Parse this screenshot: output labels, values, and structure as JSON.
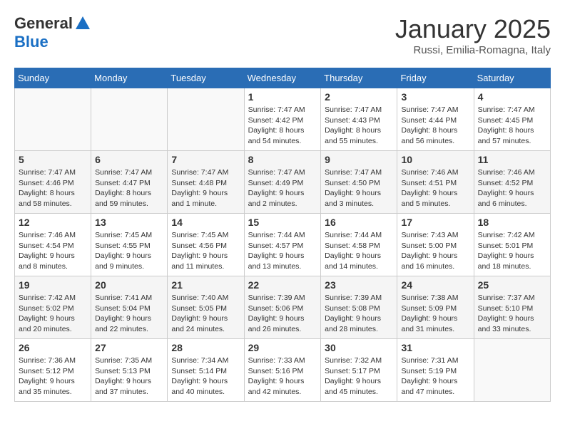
{
  "logo": {
    "general": "General",
    "blue": "Blue"
  },
  "title": "January 2025",
  "location": "Russi, Emilia-Romagna, Italy",
  "days_of_week": [
    "Sunday",
    "Monday",
    "Tuesday",
    "Wednesday",
    "Thursday",
    "Friday",
    "Saturday"
  ],
  "weeks": [
    [
      {
        "day": "",
        "info": ""
      },
      {
        "day": "",
        "info": ""
      },
      {
        "day": "",
        "info": ""
      },
      {
        "day": "1",
        "info": "Sunrise: 7:47 AM\nSunset: 4:42 PM\nDaylight: 8 hours\nand 54 minutes."
      },
      {
        "day": "2",
        "info": "Sunrise: 7:47 AM\nSunset: 4:43 PM\nDaylight: 8 hours\nand 55 minutes."
      },
      {
        "day": "3",
        "info": "Sunrise: 7:47 AM\nSunset: 4:44 PM\nDaylight: 8 hours\nand 56 minutes."
      },
      {
        "day": "4",
        "info": "Sunrise: 7:47 AM\nSunset: 4:45 PM\nDaylight: 8 hours\nand 57 minutes."
      }
    ],
    [
      {
        "day": "5",
        "info": "Sunrise: 7:47 AM\nSunset: 4:46 PM\nDaylight: 8 hours\nand 58 minutes."
      },
      {
        "day": "6",
        "info": "Sunrise: 7:47 AM\nSunset: 4:47 PM\nDaylight: 8 hours\nand 59 minutes."
      },
      {
        "day": "7",
        "info": "Sunrise: 7:47 AM\nSunset: 4:48 PM\nDaylight: 9 hours\nand 1 minute."
      },
      {
        "day": "8",
        "info": "Sunrise: 7:47 AM\nSunset: 4:49 PM\nDaylight: 9 hours\nand 2 minutes."
      },
      {
        "day": "9",
        "info": "Sunrise: 7:47 AM\nSunset: 4:50 PM\nDaylight: 9 hours\nand 3 minutes."
      },
      {
        "day": "10",
        "info": "Sunrise: 7:46 AM\nSunset: 4:51 PM\nDaylight: 9 hours\nand 5 minutes."
      },
      {
        "day": "11",
        "info": "Sunrise: 7:46 AM\nSunset: 4:52 PM\nDaylight: 9 hours\nand 6 minutes."
      }
    ],
    [
      {
        "day": "12",
        "info": "Sunrise: 7:46 AM\nSunset: 4:54 PM\nDaylight: 9 hours\nand 8 minutes."
      },
      {
        "day": "13",
        "info": "Sunrise: 7:45 AM\nSunset: 4:55 PM\nDaylight: 9 hours\nand 9 minutes."
      },
      {
        "day": "14",
        "info": "Sunrise: 7:45 AM\nSunset: 4:56 PM\nDaylight: 9 hours\nand 11 minutes."
      },
      {
        "day": "15",
        "info": "Sunrise: 7:44 AM\nSunset: 4:57 PM\nDaylight: 9 hours\nand 13 minutes."
      },
      {
        "day": "16",
        "info": "Sunrise: 7:44 AM\nSunset: 4:58 PM\nDaylight: 9 hours\nand 14 minutes."
      },
      {
        "day": "17",
        "info": "Sunrise: 7:43 AM\nSunset: 5:00 PM\nDaylight: 9 hours\nand 16 minutes."
      },
      {
        "day": "18",
        "info": "Sunrise: 7:42 AM\nSunset: 5:01 PM\nDaylight: 9 hours\nand 18 minutes."
      }
    ],
    [
      {
        "day": "19",
        "info": "Sunrise: 7:42 AM\nSunset: 5:02 PM\nDaylight: 9 hours\nand 20 minutes."
      },
      {
        "day": "20",
        "info": "Sunrise: 7:41 AM\nSunset: 5:04 PM\nDaylight: 9 hours\nand 22 minutes."
      },
      {
        "day": "21",
        "info": "Sunrise: 7:40 AM\nSunset: 5:05 PM\nDaylight: 9 hours\nand 24 minutes."
      },
      {
        "day": "22",
        "info": "Sunrise: 7:39 AM\nSunset: 5:06 PM\nDaylight: 9 hours\nand 26 minutes."
      },
      {
        "day": "23",
        "info": "Sunrise: 7:39 AM\nSunset: 5:08 PM\nDaylight: 9 hours\nand 28 minutes."
      },
      {
        "day": "24",
        "info": "Sunrise: 7:38 AM\nSunset: 5:09 PM\nDaylight: 9 hours\nand 31 minutes."
      },
      {
        "day": "25",
        "info": "Sunrise: 7:37 AM\nSunset: 5:10 PM\nDaylight: 9 hours\nand 33 minutes."
      }
    ],
    [
      {
        "day": "26",
        "info": "Sunrise: 7:36 AM\nSunset: 5:12 PM\nDaylight: 9 hours\nand 35 minutes."
      },
      {
        "day": "27",
        "info": "Sunrise: 7:35 AM\nSunset: 5:13 PM\nDaylight: 9 hours\nand 37 minutes."
      },
      {
        "day": "28",
        "info": "Sunrise: 7:34 AM\nSunset: 5:14 PM\nDaylight: 9 hours\nand 40 minutes."
      },
      {
        "day": "29",
        "info": "Sunrise: 7:33 AM\nSunset: 5:16 PM\nDaylight: 9 hours\nand 42 minutes."
      },
      {
        "day": "30",
        "info": "Sunrise: 7:32 AM\nSunset: 5:17 PM\nDaylight: 9 hours\nand 45 minutes."
      },
      {
        "day": "31",
        "info": "Sunrise: 7:31 AM\nSunset: 5:19 PM\nDaylight: 9 hours\nand 47 minutes."
      },
      {
        "day": "",
        "info": ""
      }
    ]
  ]
}
